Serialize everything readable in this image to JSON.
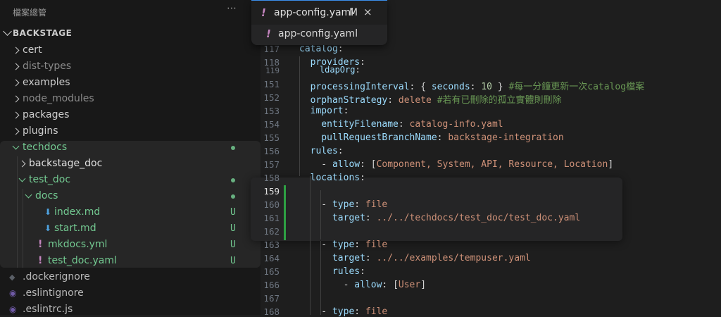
{
  "sidebar": {
    "title": "檔案總管",
    "more_icon": "⋯",
    "root": "BACKSTAGE",
    "items": [
      {
        "label": "cert",
        "kind": "folder-closed",
        "status": ""
      },
      {
        "label": "dist-types",
        "kind": "folder-closed",
        "status": ""
      },
      {
        "label": "examples",
        "kind": "folder-closed",
        "status": ""
      },
      {
        "label": "node_modules",
        "kind": "folder-closed",
        "status": ""
      },
      {
        "label": "packages",
        "kind": "folder-closed",
        "status": ""
      },
      {
        "label": "plugins",
        "kind": "folder-closed",
        "status": ""
      },
      {
        "label": "techdocs",
        "kind": "folder-open",
        "status": "dot"
      },
      {
        "label": "backstage_doc",
        "kind": "folder-closed",
        "status": ""
      },
      {
        "label": "test_doc",
        "kind": "folder-open",
        "status": "dot"
      },
      {
        "label": "docs",
        "kind": "folder-open",
        "status": "dot"
      },
      {
        "label": "index.md",
        "kind": "markdown-file",
        "status": "U"
      },
      {
        "label": "start.md",
        "kind": "markdown-file",
        "status": "U"
      },
      {
        "label": "mkdocs.yml",
        "kind": "yaml-file",
        "status": "U"
      },
      {
        "label": "test_doc.yaml",
        "kind": "yaml-file",
        "status": "U"
      },
      {
        "label": ".dockerignore",
        "kind": "docker-file",
        "status": ""
      },
      {
        "label": ".eslintignore",
        "kind": "eslint-file",
        "status": ""
      },
      {
        "label": ".eslintrc.js",
        "kind": "eslint-file",
        "status": ""
      }
    ]
  },
  "tab": {
    "icon": "!",
    "label": "app-config.yaml",
    "modified": "M",
    "close_icon": "×",
    "breadcrumb": "app-config.yaml"
  },
  "colors": {
    "accent_green": "#73c991",
    "yaml_icon": "#c586c0",
    "markdown_icon": "#4fa3e0"
  },
  "editor": {
    "current_line": "159",
    "lines": [
      {
        "n": "117",
        "tokens": [
          {
            "t": "catalog",
            "c": "key"
          },
          {
            "t": ":",
            "c": "punct"
          }
        ]
      },
      {
        "n": "118",
        "tokens": [
          {
            "t": "  providers",
            "c": "key"
          },
          {
            "t": ":",
            "c": "punct"
          }
        ]
      },
      {
        "n": "119",
        "tokens": [
          {
            "t": "    ldapOrg",
            "c": "key"
          },
          {
            "t": ":",
            "c": "punct"
          }
        ]
      },
      {
        "n": "151",
        "tokens": [
          {
            "t": "  processingInterval",
            "c": "key"
          },
          {
            "t": ": { ",
            "c": "punct"
          },
          {
            "t": "seconds",
            "c": "key"
          },
          {
            "t": ": ",
            "c": "punct"
          },
          {
            "t": "10",
            "c": "num"
          },
          {
            "t": " } ",
            "c": "punct"
          },
          {
            "t": "#每一分鐘更新一次catalog檔案",
            "c": "comment"
          }
        ]
      },
      {
        "n": "152",
        "tokens": [
          {
            "t": "  orphanStrategy",
            "c": "key"
          },
          {
            "t": ": ",
            "c": "punct"
          },
          {
            "t": "delete",
            "c": "str"
          },
          {
            "t": " ",
            "c": "punct"
          },
          {
            "t": "#若有已刪除的孤立實體則刪除",
            "c": "comment"
          }
        ]
      },
      {
        "n": "153",
        "tokens": [
          {
            "t": "  import",
            "c": "key"
          },
          {
            "t": ":",
            "c": "punct"
          }
        ]
      },
      {
        "n": "154",
        "tokens": [
          {
            "t": "    entityFilename",
            "c": "key"
          },
          {
            "t": ": ",
            "c": "punct"
          },
          {
            "t": "catalog-info.yaml",
            "c": "str"
          }
        ]
      },
      {
        "n": "155",
        "tokens": [
          {
            "t": "    pullRequestBranchName",
            "c": "key"
          },
          {
            "t": ": ",
            "c": "punct"
          },
          {
            "t": "backstage-integration",
            "c": "str"
          }
        ]
      },
      {
        "n": "156",
        "tokens": [
          {
            "t": "  rules",
            "c": "key"
          },
          {
            "t": ":",
            "c": "punct"
          }
        ]
      },
      {
        "n": "157",
        "tokens": [
          {
            "t": "    - ",
            "c": "punct"
          },
          {
            "t": "allow",
            "c": "key"
          },
          {
            "t": ": [",
            "c": "punct"
          },
          {
            "t": "Component, System, API, Resource, Location",
            "c": "str"
          },
          {
            "t": "]",
            "c": "punct"
          }
        ]
      },
      {
        "n": "158",
        "tokens": [
          {
            "t": "  locations",
            "c": "key"
          },
          {
            "t": ":",
            "c": "punct"
          }
        ]
      },
      {
        "n": "159",
        "tokens": [
          {
            "t": "",
            "c": "punct"
          }
        ]
      },
      {
        "n": "160",
        "tokens": [
          {
            "t": "    - ",
            "c": "punct"
          },
          {
            "t": "type",
            "c": "key"
          },
          {
            "t": ": ",
            "c": "punct"
          },
          {
            "t": "file",
            "c": "str"
          }
        ]
      },
      {
        "n": "161",
        "tokens": [
          {
            "t": "      target",
            "c": "key"
          },
          {
            "t": ": ",
            "c": "punct"
          },
          {
            "t": "../../techdocs/test_doc/test_doc.yaml",
            "c": "str"
          }
        ]
      },
      {
        "n": "162",
        "tokens": [
          {
            "t": "",
            "c": "punct"
          }
        ]
      },
      {
        "n": "163",
        "tokens": [
          {
            "t": "    - ",
            "c": "punct"
          },
          {
            "t": "type",
            "c": "key"
          },
          {
            "t": ": ",
            "c": "punct"
          },
          {
            "t": "file",
            "c": "str"
          }
        ]
      },
      {
        "n": "164",
        "tokens": [
          {
            "t": "      target",
            "c": "key"
          },
          {
            "t": ": ",
            "c": "punct"
          },
          {
            "t": "../../examples/tempuser.yaml",
            "c": "str"
          }
        ]
      },
      {
        "n": "165",
        "tokens": [
          {
            "t": "      rules",
            "c": "key"
          },
          {
            "t": ":",
            "c": "punct"
          }
        ]
      },
      {
        "n": "166",
        "tokens": [
          {
            "t": "        - ",
            "c": "punct"
          },
          {
            "t": "allow",
            "c": "key"
          },
          {
            "t": ": [",
            "c": "punct"
          },
          {
            "t": "User",
            "c": "str"
          },
          {
            "t": "]",
            "c": "punct"
          }
        ]
      },
      {
        "n": "167",
        "tokens": [
          {
            "t": "",
            "c": "punct"
          }
        ]
      },
      {
        "n": "168",
        "tokens": [
          {
            "t": "    - ",
            "c": "punct"
          },
          {
            "t": "type",
            "c": "key"
          },
          {
            "t": ": ",
            "c": "punct"
          },
          {
            "t": "file",
            "c": "str"
          }
        ]
      }
    ]
  }
}
